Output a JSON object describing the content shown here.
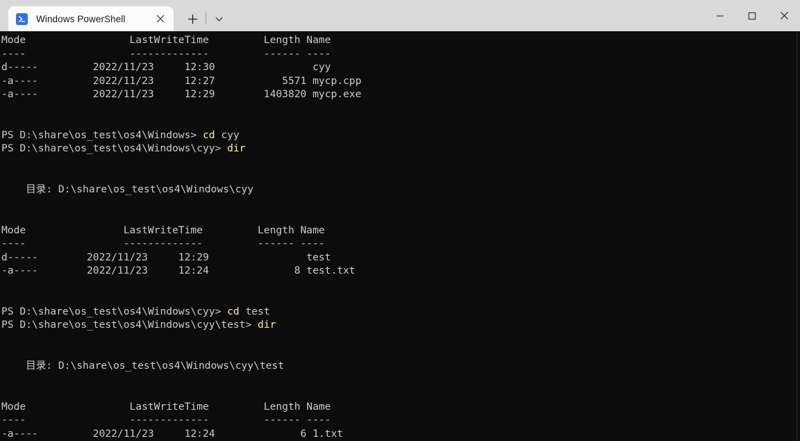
{
  "window": {
    "tab": {
      "title": "Windows PowerShell",
      "icon": "powershell-prompt-icon",
      "close_label": "×"
    },
    "new_tab_label": "+",
    "dropdown_label": "˅",
    "controls": {
      "minimize": "—",
      "maximize": "☐",
      "close": "×"
    }
  },
  "theme": {
    "titlebar_bg": "#d9d9d9",
    "tab_bg": "#fbfbfb",
    "terminal_bg": "#0c0c0c",
    "foreground": "#cccccc",
    "command_color": "#f9f1a5",
    "icon_accent": "#3a6fd8"
  },
  "terminal": {
    "lines": [
      {
        "text": "Mode                 LastWriteTime         Length Name"
      },
      {
        "text": "----                 -------------         ------ ----"
      },
      {
        "text": "d-----         2022/11/23     12:30                cyy"
      },
      {
        "text": "-a----         2022/11/23     12:27           5571 mycp.cpp"
      },
      {
        "text": "-a----         2022/11/23     12:29        1403820 mycp.exe"
      },
      {
        "text": ""
      },
      {
        "text": ""
      },
      {
        "prompt": "PS D:\\share\\os_test\\os4\\Windows> ",
        "command": "cd",
        "args": " cyy"
      },
      {
        "prompt": "PS D:\\share\\os_test\\os4\\Windows\\cyy> ",
        "command": "dir",
        "args": ""
      },
      {
        "text": ""
      },
      {
        "text": ""
      },
      {
        "text": "    目录: D:\\share\\os_test\\os4\\Windows\\cyy"
      },
      {
        "text": ""
      },
      {
        "text": ""
      },
      {
        "text": "Mode                LastWriteTime         Length Name"
      },
      {
        "text": "----                -------------         ------ ----"
      },
      {
        "text": "d-----        2022/11/23     12:29                test"
      },
      {
        "text": "-a----        2022/11/23     12:24              8 test.txt"
      },
      {
        "text": ""
      },
      {
        "text": ""
      },
      {
        "prompt": "PS D:\\share\\os_test\\os4\\Windows\\cyy> ",
        "command": "cd",
        "args": " test"
      },
      {
        "prompt": "PS D:\\share\\os_test\\os4\\Windows\\cyy\\test> ",
        "command": "dir",
        "args": ""
      },
      {
        "text": ""
      },
      {
        "text": ""
      },
      {
        "text": "    目录: D:\\share\\os_test\\os4\\Windows\\cyy\\test"
      },
      {
        "text": ""
      },
      {
        "text": ""
      },
      {
        "text": "Mode                 LastWriteTime         Length Name"
      },
      {
        "text": "----                 -------------         ------ ----"
      },
      {
        "text": "-a----         2022/11/23     12:24              6 1.txt"
      }
    ]
  }
}
